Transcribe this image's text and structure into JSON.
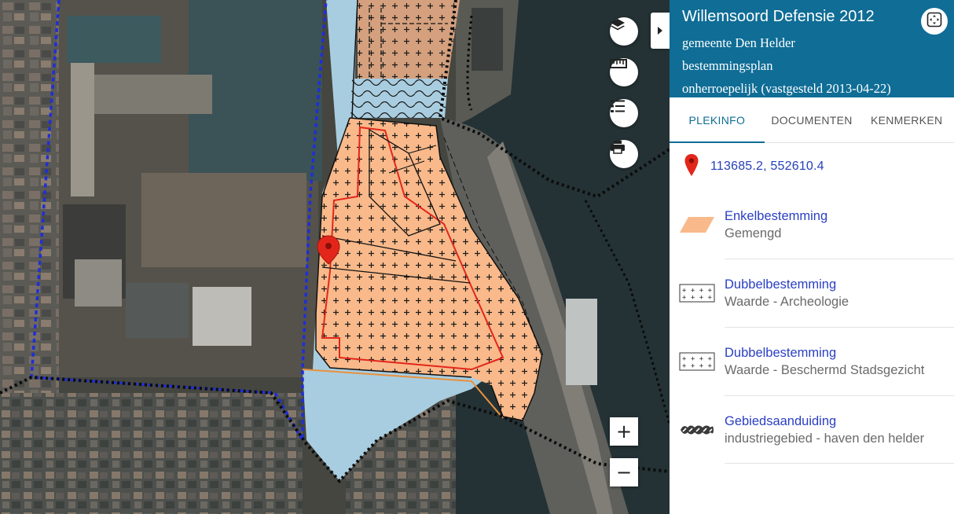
{
  "plan": {
    "title": "Willemsoord Defensie 2012",
    "municipality": "gemeente Den Helder",
    "type": "bestemmingsplan",
    "status": "onherroepelijk (vastgesteld 2013-04-22)"
  },
  "tabs": [
    {
      "label": "PLEKINFO",
      "active": true
    },
    {
      "label": "DOCUMENTEN",
      "active": false
    },
    {
      "label": "KENMERKEN",
      "active": false
    }
  ],
  "location": {
    "coordinates": "113685.2, 552610.4",
    "icon": "map-pin-icon"
  },
  "legend": [
    {
      "type": "Enkelbestemming",
      "value": "Gemengd",
      "swatch": "orange-parallelogram"
    },
    {
      "type": "Dubbelbestemming",
      "value": "Waarde - Archeologie",
      "swatch": "plus-grid"
    },
    {
      "type": "Dubbelbestemming",
      "value": "Waarde - Beschermd Stadsgezicht",
      "swatch": "plus-grid"
    },
    {
      "type": "Gebiedsaanduiding",
      "value": "industriegebied - haven den helder",
      "swatch": "hatched-band"
    }
  ],
  "map_controls": {
    "zoom_in": "+",
    "zoom_out": "−",
    "buttons": [
      "layers-icon",
      "ruler-icon",
      "legend-list-icon",
      "print-icon"
    ]
  },
  "colors": {
    "header": "#0f6d96",
    "accent": "#0f6d96",
    "link": "#2a3fc2",
    "plan_fill": "#f9b98a",
    "water": "#a9cde0",
    "pin": "#e3261b"
  }
}
